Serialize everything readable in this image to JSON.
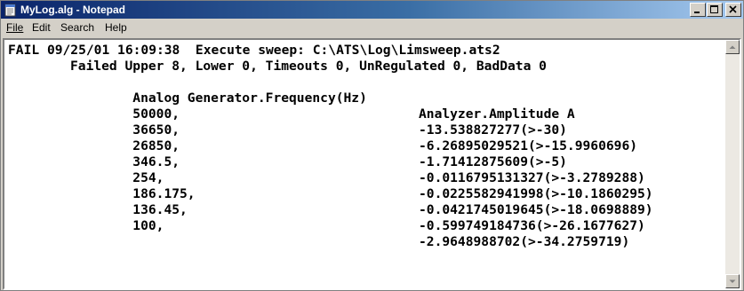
{
  "window": {
    "title": "MyLog.alg - Notepad",
    "icon": "notepad-icon",
    "buttons": [
      "minimize-icon",
      "maximize-icon",
      "close-icon"
    ]
  },
  "menu": {
    "file": "File",
    "edit": "Edit",
    "search": "Search",
    "help": "Help"
  },
  "log": {
    "header": {
      "status": "FAIL",
      "date": "09/25/01",
      "time": "16:09:38",
      "action": "Execute sweep:",
      "path": "C:\\ATS\\Log\\Limsweep.ats2"
    },
    "summary": "Failed Upper 8, Lower 0, Timeouts 0, UnRegulated 0, BadData 0",
    "columns": [
      "Analog Generator.Frequency(Hz)",
      "Analyzer.Amplitude A"
    ],
    "rows": [
      [
        "50000,",
        "-13.538827277(>-30)"
      ],
      [
        "36650,",
        "-6.26895029521(>-15.9960696)"
      ],
      [
        "26850,",
        "-1.71412875609(>-5)"
      ],
      [
        "346.5,",
        "-0.0116795131327(>-3.2789288)"
      ],
      [
        "254,",
        "-0.0225582941998(>-10.1860295)"
      ],
      [
        "186.175,",
        "-0.0421745019645(>-18.0698889)"
      ],
      [
        "136.45,",
        "-0.599749184736(>-26.1677627)"
      ],
      [
        "100,",
        "-2.9648988702(>-34.2759719)"
      ]
    ]
  }
}
